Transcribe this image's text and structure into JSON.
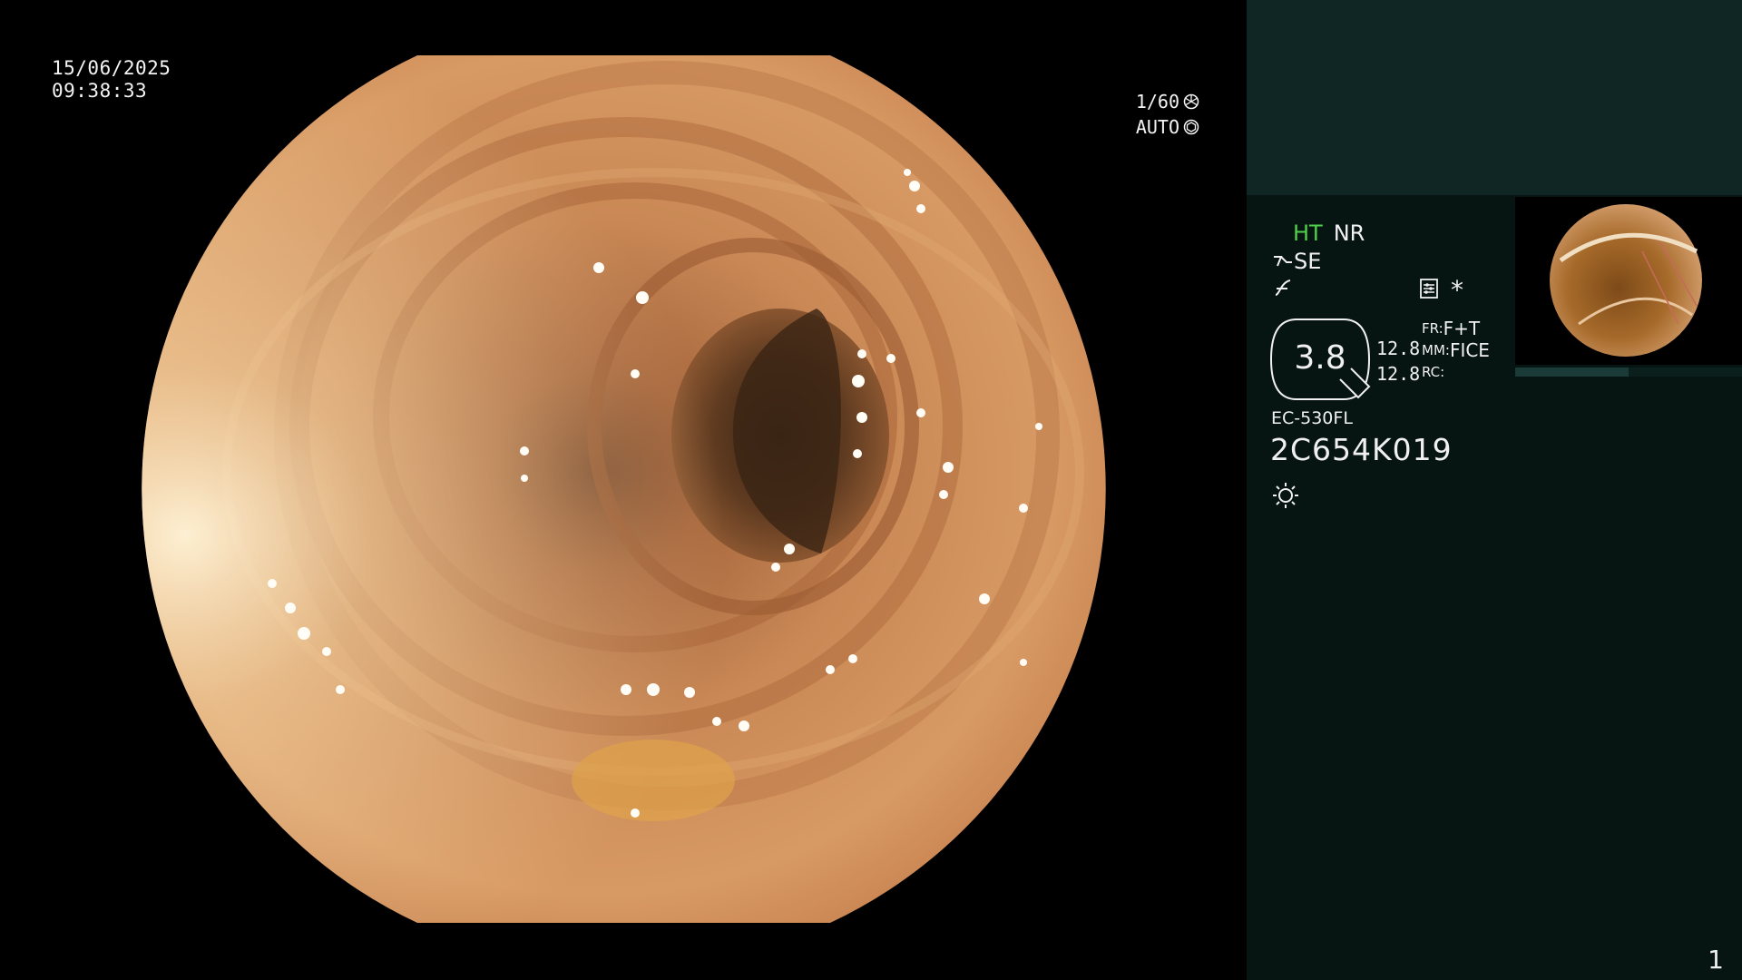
{
  "overlay": {
    "date": "15/06/2025",
    "time": "09:38:33",
    "shutter": "1/60",
    "iris_mode": "AUTO",
    "shutter_icon": "shutter-icon",
    "iris_icon": "iris-icon"
  },
  "panel": {
    "ht_label": "HT",
    "nr_label": "NR",
    "se_label": "SE",
    "zoom_value": "3.8",
    "ratio_top": "12.8",
    "ratio_bottom": "12.8",
    "fr_label": "FR:",
    "fr_value": "F+T",
    "mm_label": "MM:",
    "mm_value": "FICE",
    "rc_label": "RC:",
    "asterisk": "*",
    "scope_model": "EC-530FL",
    "scope_serial": "2C654K019",
    "page_number": "1",
    "colors": {
      "ht": "#4fd14a",
      "panel_bg": "#061512",
      "panel_top": "#0f2624"
    }
  }
}
